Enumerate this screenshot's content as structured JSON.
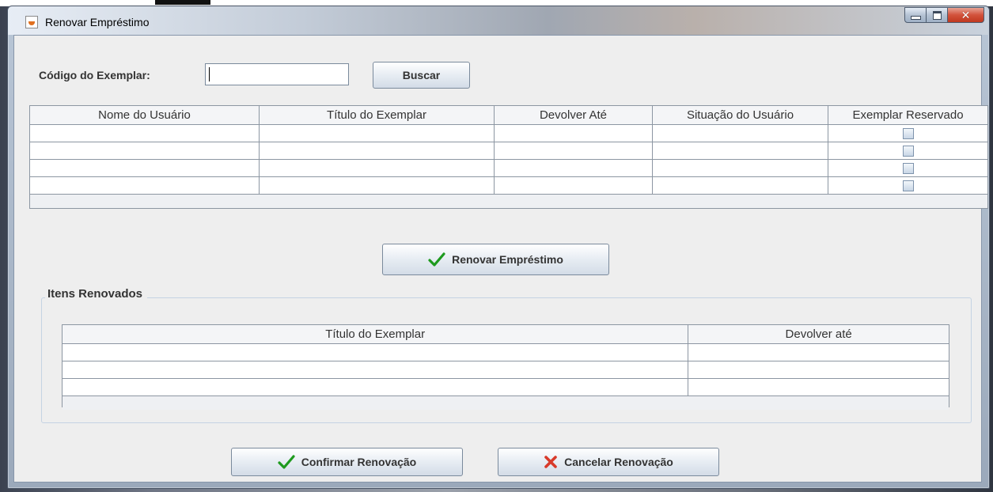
{
  "window": {
    "title": "Renovar Empréstimo",
    "controls": {
      "minimize": "minimize",
      "maximize": "maximize",
      "close": "x"
    }
  },
  "search": {
    "label": "Código do Exemplar:",
    "value": "",
    "button_label": "Buscar"
  },
  "main_table": {
    "columns": [
      "Nome do Usuário",
      "Título do Exemplar",
      "Devolver Até",
      "Situação do Usuário",
      "Exemplar Reservado"
    ],
    "rows": [
      {
        "nome": "",
        "titulo": "",
        "devolver": "",
        "situacao": "",
        "reservado": false
      },
      {
        "nome": "",
        "titulo": "",
        "devolver": "",
        "situacao": "",
        "reservado": false
      },
      {
        "nome": "",
        "titulo": "",
        "devolver": "",
        "situacao": "",
        "reservado": false
      },
      {
        "nome": "",
        "titulo": "",
        "devolver": "",
        "situacao": "",
        "reservado": false
      }
    ]
  },
  "actions": {
    "renovar_label": "Renovar Empréstimo",
    "confirmar_label": "Confirmar Renovação",
    "cancelar_label": "Cancelar Renovação"
  },
  "itens_renovados": {
    "title": "Itens Renovados",
    "columns": [
      "Título do Exemplar",
      "Devolver até"
    ],
    "rows": [
      {
        "titulo": "",
        "devolver": ""
      },
      {
        "titulo": "",
        "devolver": ""
      },
      {
        "titulo": "",
        "devolver": ""
      }
    ]
  },
  "colors": {
    "check_green": "#1e9a1e",
    "cancel_red": "#d83a2a",
    "window_bg": "#eeeeee",
    "close_button": "#c8452c"
  },
  "icons": {
    "app": "java-cup-icon",
    "renovar": "checkmark-icon",
    "confirmar": "checkmark-icon",
    "cancelar": "red-x-icon"
  }
}
